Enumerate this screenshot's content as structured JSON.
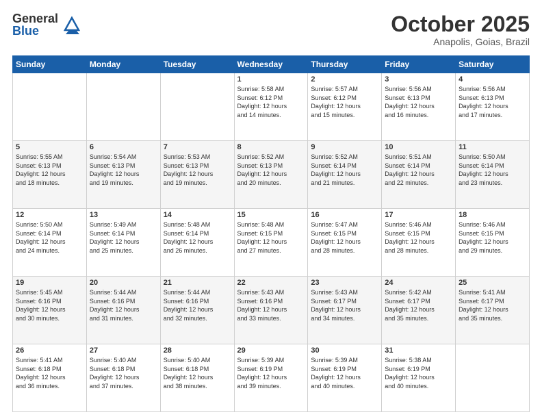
{
  "header": {
    "logo_general": "General",
    "logo_blue": "Blue",
    "month_title": "October 2025",
    "location": "Anapolis, Goias, Brazil"
  },
  "days_of_week": [
    "Sunday",
    "Monday",
    "Tuesday",
    "Wednesday",
    "Thursday",
    "Friday",
    "Saturday"
  ],
  "weeks": [
    [
      {
        "day": "",
        "info": ""
      },
      {
        "day": "",
        "info": ""
      },
      {
        "day": "",
        "info": ""
      },
      {
        "day": "1",
        "info": "Sunrise: 5:58 AM\nSunset: 6:12 PM\nDaylight: 12 hours\nand 14 minutes."
      },
      {
        "day": "2",
        "info": "Sunrise: 5:57 AM\nSunset: 6:12 PM\nDaylight: 12 hours\nand 15 minutes."
      },
      {
        "day": "3",
        "info": "Sunrise: 5:56 AM\nSunset: 6:13 PM\nDaylight: 12 hours\nand 16 minutes."
      },
      {
        "day": "4",
        "info": "Sunrise: 5:56 AM\nSunset: 6:13 PM\nDaylight: 12 hours\nand 17 minutes."
      }
    ],
    [
      {
        "day": "5",
        "info": "Sunrise: 5:55 AM\nSunset: 6:13 PM\nDaylight: 12 hours\nand 18 minutes."
      },
      {
        "day": "6",
        "info": "Sunrise: 5:54 AM\nSunset: 6:13 PM\nDaylight: 12 hours\nand 19 minutes."
      },
      {
        "day": "7",
        "info": "Sunrise: 5:53 AM\nSunset: 6:13 PM\nDaylight: 12 hours\nand 19 minutes."
      },
      {
        "day": "8",
        "info": "Sunrise: 5:52 AM\nSunset: 6:13 PM\nDaylight: 12 hours\nand 20 minutes."
      },
      {
        "day": "9",
        "info": "Sunrise: 5:52 AM\nSunset: 6:14 PM\nDaylight: 12 hours\nand 21 minutes."
      },
      {
        "day": "10",
        "info": "Sunrise: 5:51 AM\nSunset: 6:14 PM\nDaylight: 12 hours\nand 22 minutes."
      },
      {
        "day": "11",
        "info": "Sunrise: 5:50 AM\nSunset: 6:14 PM\nDaylight: 12 hours\nand 23 minutes."
      }
    ],
    [
      {
        "day": "12",
        "info": "Sunrise: 5:50 AM\nSunset: 6:14 PM\nDaylight: 12 hours\nand 24 minutes."
      },
      {
        "day": "13",
        "info": "Sunrise: 5:49 AM\nSunset: 6:14 PM\nDaylight: 12 hours\nand 25 minutes."
      },
      {
        "day": "14",
        "info": "Sunrise: 5:48 AM\nSunset: 6:14 PM\nDaylight: 12 hours\nand 26 minutes."
      },
      {
        "day": "15",
        "info": "Sunrise: 5:48 AM\nSunset: 6:15 PM\nDaylight: 12 hours\nand 27 minutes."
      },
      {
        "day": "16",
        "info": "Sunrise: 5:47 AM\nSunset: 6:15 PM\nDaylight: 12 hours\nand 28 minutes."
      },
      {
        "day": "17",
        "info": "Sunrise: 5:46 AM\nSunset: 6:15 PM\nDaylight: 12 hours\nand 28 minutes."
      },
      {
        "day": "18",
        "info": "Sunrise: 5:46 AM\nSunset: 6:15 PM\nDaylight: 12 hours\nand 29 minutes."
      }
    ],
    [
      {
        "day": "19",
        "info": "Sunrise: 5:45 AM\nSunset: 6:16 PM\nDaylight: 12 hours\nand 30 minutes."
      },
      {
        "day": "20",
        "info": "Sunrise: 5:44 AM\nSunset: 6:16 PM\nDaylight: 12 hours\nand 31 minutes."
      },
      {
        "day": "21",
        "info": "Sunrise: 5:44 AM\nSunset: 6:16 PM\nDaylight: 12 hours\nand 32 minutes."
      },
      {
        "day": "22",
        "info": "Sunrise: 5:43 AM\nSunset: 6:16 PM\nDaylight: 12 hours\nand 33 minutes."
      },
      {
        "day": "23",
        "info": "Sunrise: 5:43 AM\nSunset: 6:17 PM\nDaylight: 12 hours\nand 34 minutes."
      },
      {
        "day": "24",
        "info": "Sunrise: 5:42 AM\nSunset: 6:17 PM\nDaylight: 12 hours\nand 35 minutes."
      },
      {
        "day": "25",
        "info": "Sunrise: 5:41 AM\nSunset: 6:17 PM\nDaylight: 12 hours\nand 35 minutes."
      }
    ],
    [
      {
        "day": "26",
        "info": "Sunrise: 5:41 AM\nSunset: 6:18 PM\nDaylight: 12 hours\nand 36 minutes."
      },
      {
        "day": "27",
        "info": "Sunrise: 5:40 AM\nSunset: 6:18 PM\nDaylight: 12 hours\nand 37 minutes."
      },
      {
        "day": "28",
        "info": "Sunrise: 5:40 AM\nSunset: 6:18 PM\nDaylight: 12 hours\nand 38 minutes."
      },
      {
        "day": "29",
        "info": "Sunrise: 5:39 AM\nSunset: 6:19 PM\nDaylight: 12 hours\nand 39 minutes."
      },
      {
        "day": "30",
        "info": "Sunrise: 5:39 AM\nSunset: 6:19 PM\nDaylight: 12 hours\nand 40 minutes."
      },
      {
        "day": "31",
        "info": "Sunrise: 5:38 AM\nSunset: 6:19 PM\nDaylight: 12 hours\nand 40 minutes."
      },
      {
        "day": "",
        "info": ""
      }
    ]
  ]
}
